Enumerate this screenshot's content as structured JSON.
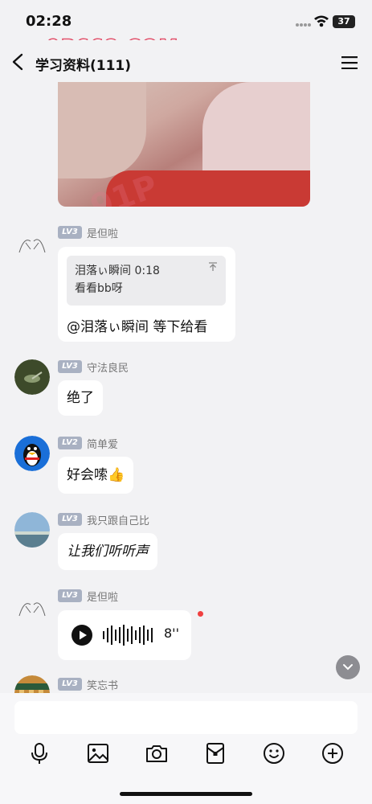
{
  "status_bar": {
    "time": "02:28",
    "battery": "37"
  },
  "watermark": "9P668.COM",
  "header": {
    "title": "学习资料(111)"
  },
  "photo_watermark": "91P",
  "messages": [
    {
      "level": "LV3",
      "nickname": "是但啦",
      "quote_line1": "泪落ぃ瞬间 0:18",
      "quote_line2": "看看bb呀",
      "text": "@泪落ぃ瞬间 等下给看"
    },
    {
      "level": "LV3",
      "nickname": "守法良民",
      "text": "绝了"
    },
    {
      "level": "LV2",
      "nickname": "简单爱",
      "text": "好会嗦👍"
    },
    {
      "level": "LV3",
      "nickname": "我只跟自己比",
      "text": "让我们听听声"
    },
    {
      "level": "LV3",
      "nickname": "是但啦",
      "voice_duration": "8''"
    },
    {
      "level": "LV3",
      "nickname": "笑忘书"
    }
  ],
  "colors": {
    "level_badge": "#a9b1c2",
    "unread_dot": "#f04040",
    "background": "#f2f2f4"
  },
  "toolbar_icons": [
    "microphone-icon",
    "image-icon",
    "camera-icon",
    "red-packet-icon",
    "emoji-icon",
    "plus-icon"
  ]
}
